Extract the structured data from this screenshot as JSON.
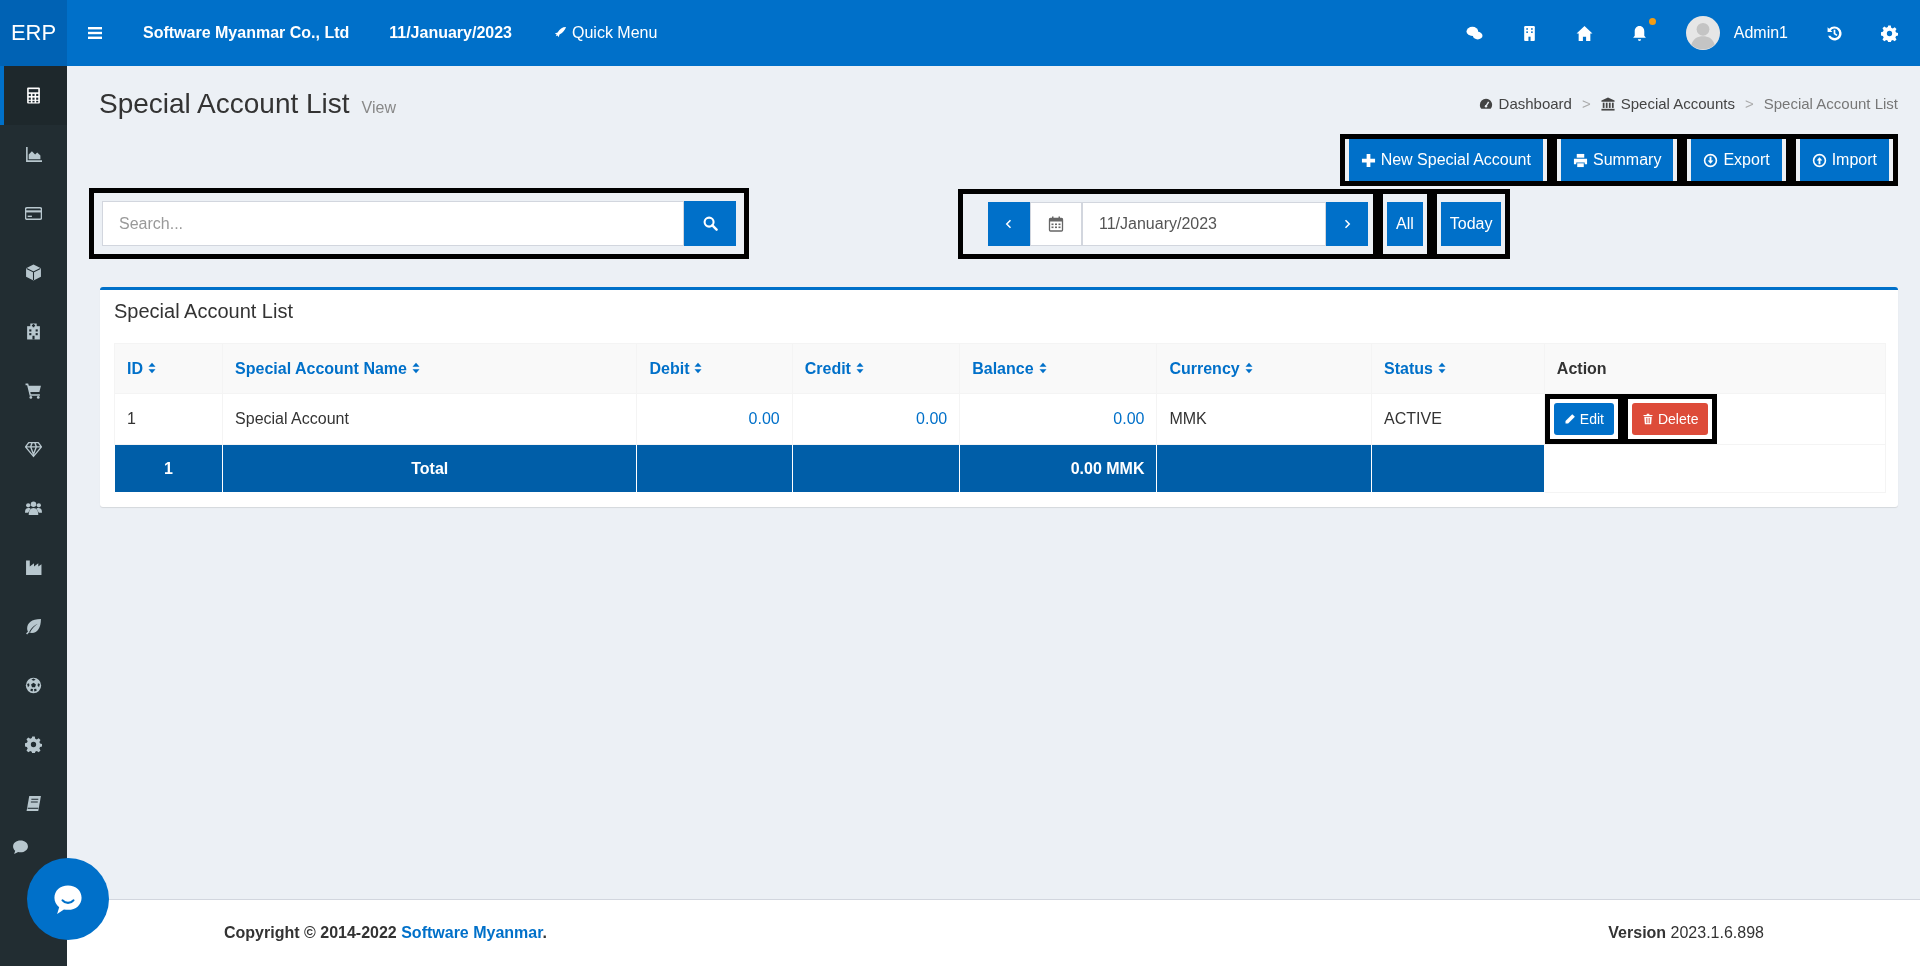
{
  "topbar": {
    "logo": "ERP",
    "company": "Software Myanmar Co., Ltd",
    "date": "11/January/2023",
    "quick_menu": "Quick Menu",
    "notification_dot": true,
    "user": "Admin1"
  },
  "sidebar": {
    "items": [
      {
        "selected": true
      },
      {
        "selected": false
      },
      {
        "selected": false
      },
      {
        "selected": false
      },
      {
        "selected": false
      },
      {
        "selected": false
      },
      {
        "selected": false
      },
      {
        "selected": false
      },
      {
        "selected": false
      },
      {
        "selected": false
      },
      {
        "selected": false
      },
      {
        "selected": false
      },
      {
        "selected": false
      },
      {
        "selected": false
      }
    ]
  },
  "page": {
    "title": "Special Account List",
    "subtitle": "View"
  },
  "breadcrumb": [
    {
      "label": "Dashboard",
      "current": false
    },
    {
      "separator": ">",
      "label": "Special Accounts",
      "current": false
    },
    {
      "separator": ">",
      "label": "Special Account List",
      "current": true
    }
  ],
  "actions": [
    "New Special Account",
    "Summary",
    "Export",
    "Import"
  ],
  "search": {
    "placeholder": "Search..."
  },
  "date_filter": {
    "value": "11/January/2023",
    "all": "All",
    "today": "Today"
  },
  "card": {
    "title": "Special Account List"
  },
  "table": {
    "columns": [
      {
        "label": "ID",
        "kind": "text",
        "sortable": true
      },
      {
        "label": "Special Account Name",
        "kind": "text",
        "sortable": true
      },
      {
        "label": "Debit",
        "kind": "amount",
        "sortable": true
      },
      {
        "label": "Credit",
        "kind": "amount",
        "sortable": true
      },
      {
        "label": "Balance",
        "kind": "amount",
        "sortable": true
      },
      {
        "label": "Currency",
        "kind": "text",
        "sortable": true
      },
      {
        "label": "Status",
        "kind": "text",
        "sortable": true
      },
      {
        "label": "Action",
        "kind": "action",
        "sortable": false
      }
    ],
    "rows": [
      {
        "cells": [
          "1",
          "Special Account",
          "0.00",
          "0.00",
          "0.00",
          "MMK",
          "ACTIVE"
        ],
        "actions": [
          "Edit",
          "Delete"
        ]
      }
    ],
    "total_row": {
      "count": "1",
      "label": "Total",
      "balance": "0.00 MMK"
    }
  },
  "footer": {
    "copyright": "Copyright © 2014-2022",
    "company": "Software Myanmar",
    "suffix": ".",
    "version_label": "Version",
    "version": "2023.1.6.898"
  }
}
